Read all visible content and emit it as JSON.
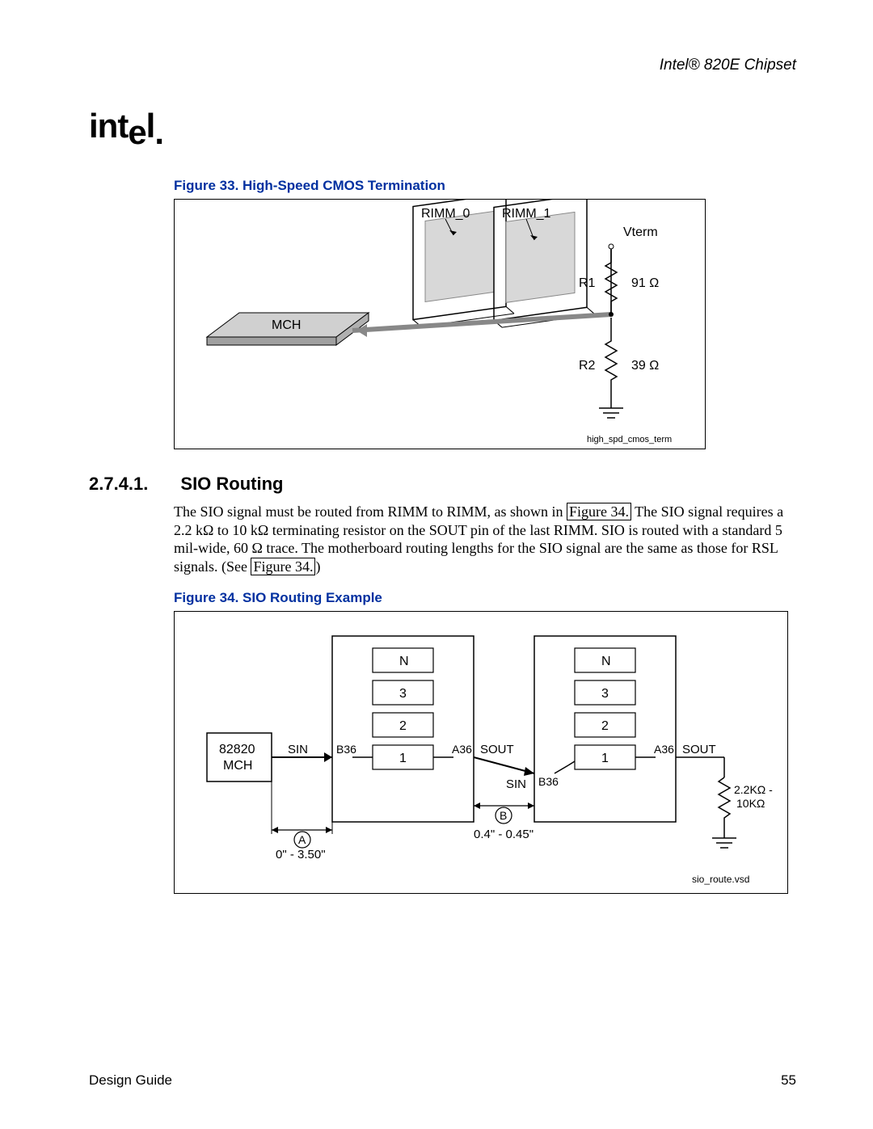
{
  "header": {
    "doc_title": "Intel® 820E Chipset",
    "logo_text": "intel"
  },
  "figure33": {
    "caption": "Figure 33. High-Speed CMOS Termination",
    "labels": {
      "rimm0": "RIMM_0",
      "rimm1": "RIMM_1",
      "vterm": "Vterm",
      "mch": "MCH",
      "r1": "R1",
      "r1_val": "91 Ω",
      "r2": "R2",
      "r2_val": "39 Ω",
      "filename": "high_spd_cmos_term"
    }
  },
  "section": {
    "number": "2.7.4.1.",
    "title": "SIO Routing",
    "paragraph": "The SIO signal must be routed from RIMM to RIMM, as shown in Figure 34. The SIO signal requires a 2.2 kΩ to 10 kΩ terminating resistor on the SOUT pin of the last RIMM. SIO is routed with a standard 5 mil-wide, 60 Ω trace. The motherboard routing lengths for the SIO signal are the same as those for RSL signals. (See Figure 34.)"
  },
  "figure34": {
    "caption": "Figure 34. SIO Routing Example",
    "labels": {
      "mch": "82820",
      "mch2": "MCH",
      "sin": "SIN",
      "sout": "SOUT",
      "b36": "B36",
      "a36": "A36",
      "n": "N",
      "three": "3",
      "two": "2",
      "one": "1",
      "a": "A",
      "b": "B",
      "a_range": "0\" - 3.50\"",
      "b_range": "0.4\" - 0.45\"",
      "term": "2.2KΩ -",
      "term2": "10KΩ",
      "filename": "sio_route.vsd"
    }
  },
  "footer": {
    "left": "Design Guide",
    "right": "55"
  }
}
